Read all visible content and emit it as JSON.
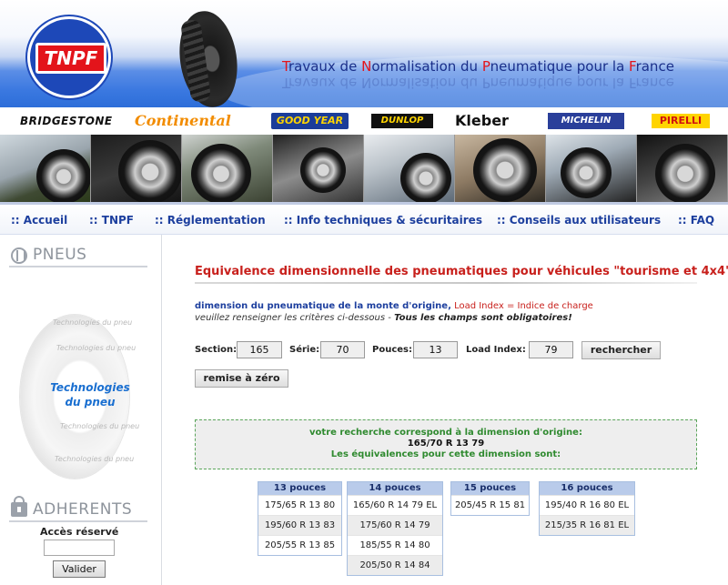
{
  "header": {
    "logo_text": "TNPF",
    "title_parts": [
      {
        "cap": "T",
        "rest": "ravaux de "
      },
      {
        "cap": "N",
        "rest": "ormalisation du "
      },
      {
        "cap": "P",
        "rest": "neumatique pour la "
      },
      {
        "cap": "F",
        "rest": "rance"
      }
    ],
    "title_full": "Travaux de Normalisation du Pneumatique pour la France"
  },
  "brands": [
    "BRIDGESTONE",
    "Continental",
    "GOOD YEAR",
    "DUNLOP",
    "Kleber",
    "MICHELIN",
    "PIRELLI"
  ],
  "nav": {
    "items": [
      {
        "label": ":: Accueil"
      },
      {
        "label": ":: TNPF"
      },
      {
        "label": ":: Réglementation"
      },
      {
        "label": ":: Info techniques & sécuritaires"
      },
      {
        "label": ":: Conseils aux utilisateurs"
      },
      {
        "label": ":: FAQ"
      }
    ]
  },
  "sidebar": {
    "pneus_title": "PNEUS",
    "tech_label_line1": "Technologies",
    "tech_label_line2": "du pneu",
    "ghost_text": "Technologies du pneu",
    "adherents_title": "ADHERENTS",
    "acces_label": "Accès réservé",
    "acces_value": "",
    "valider_label": "Valider"
  },
  "main": {
    "title": "Equivalence dimensionnelle des pneumatiques pour véhicules \"tourisme et 4x4\"",
    "intro_blue": "dimension du pneumatique de la monte d'origine,",
    "intro_red": " Load Index = Indice de charge",
    "intro2_plain": "veuillez renseigner les critères ci-dessous - ",
    "intro2_bold": "Tous les champs sont obligatoires!",
    "fields": {
      "section_label": "Section:",
      "section_value": "165",
      "serie_label": "Série:",
      "serie_value": "70",
      "pouces_label": "Pouces:",
      "pouces_value": "13",
      "load_label": "Load Index:",
      "load_value": "79"
    },
    "search_button": "rechercher",
    "reset_button": "remise à zéro",
    "result": {
      "line1": "votre recherche correspond à la dimension d'origine:",
      "line2": "165/70 R 13 79",
      "line3": "Les équivalences pour cette dimension sont:"
    },
    "columns": [
      {
        "header": "13 pouces",
        "rows": [
          "175/65 R 13 80",
          "195/60 R 13 83",
          "205/55 R 13 85"
        ]
      },
      {
        "header": "14 pouces",
        "rows": [
          "165/60 R 14 79 EL",
          "175/60 R 14 79",
          "185/55 R 14 80",
          "205/50 R 14 84"
        ]
      },
      {
        "header": "15 pouces",
        "rows": [
          "205/45 R 15 81"
        ]
      },
      {
        "header": "16 pouces",
        "rows": [
          "195/40 R 16 80 EL",
          "215/35 R 16 81 EL"
        ]
      }
    ]
  },
  "colors": {
    "nav_blue": "#1d3f9e",
    "title_red": "#c8201c",
    "result_green": "#2f8a2f",
    "column_header": "#b9cbea"
  }
}
